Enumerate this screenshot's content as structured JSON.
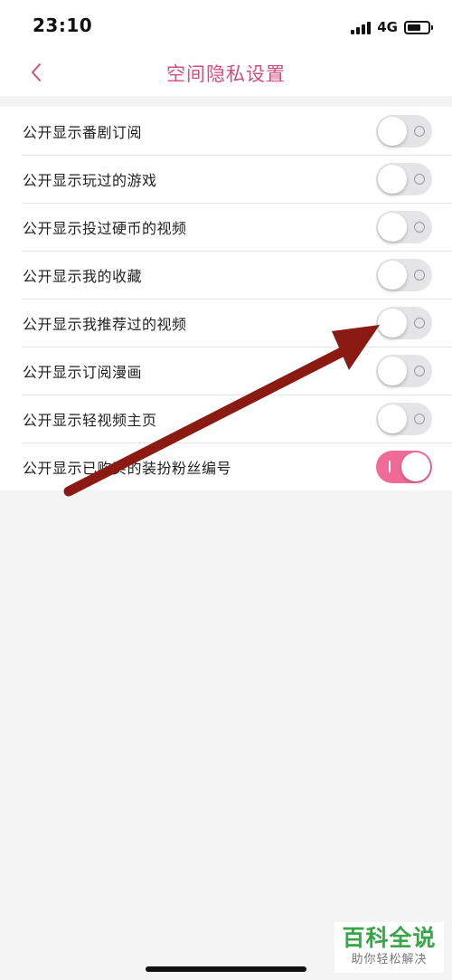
{
  "status_bar": {
    "time": "23:10",
    "network": "4G",
    "battery_level": 0.68
  },
  "header": {
    "title": "空间隐私设置",
    "back_icon": "chevron-left-icon",
    "accent_color": "#d24f7d"
  },
  "settings": [
    {
      "label": "公开显示番剧订阅",
      "enabled": false
    },
    {
      "label": "公开显示玩过的游戏",
      "enabled": false
    },
    {
      "label": "公开显示投过硬币的视频",
      "enabled": false
    },
    {
      "label": "公开显示我的收藏",
      "enabled": false
    },
    {
      "label": "公开显示我推荐过的视频",
      "enabled": false
    },
    {
      "label": "公开显示订阅漫画",
      "enabled": false
    },
    {
      "label": "公开显示轻视频主页",
      "enabled": false
    },
    {
      "label": "公开显示已购买的装扮粉丝编号",
      "enabled": true
    }
  ],
  "toggle_on_color": "#f06b97",
  "annotation_arrow_color": "#8b1a12",
  "watermark": {
    "title": "百科全说",
    "subtitle": "助你轻松解决"
  }
}
